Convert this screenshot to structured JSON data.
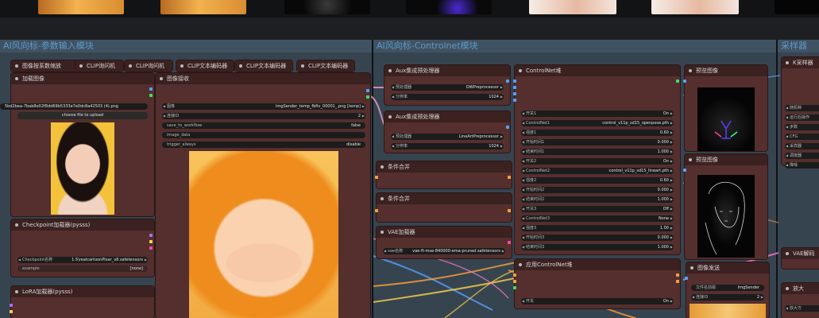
{
  "groups": {
    "left_title": "AI风向标-参数输入模块",
    "mid_title": "AI风向标-Controlnet模块",
    "right_title": "采样器"
  },
  "collapsed_nodes": {
    "resize": "图像按系数缩放",
    "clip1": "CLIP询问机",
    "clip2": "CLIP询问机",
    "clip3": "CLIP文本编码器",
    "clip4": "CLIP文本编码器",
    "clip5": "CLIP文本编码器"
  },
  "load_image": {
    "title": "加载图像",
    "filename": "5bd2bea-7bab8e02f8dd69b5333e7e0dc8a42503 (4).png",
    "upload_label": "choose file to upload"
  },
  "checkpoint": {
    "title": "Checkpoint加载器(pysss)",
    "ckpt_label": "Checkpoint名称",
    "ckpt_value": "1.5\\realcartoonPixar_v8.safetensors",
    "example_label": "example",
    "example_value": "[none]"
  },
  "lora": {
    "title": "LoRA加载器(pysss)"
  },
  "image_receive": {
    "title": "图像接收",
    "image_label": "图像",
    "image_value": "ImgSender_temp_fbfiv_00001_.png [temp]",
    "link_label": "连接ID",
    "link_value": "2",
    "save_label": "save_to_workflow",
    "save_value": "false",
    "image_data": "image_data",
    "trigger_label": "trigger_always",
    "trigger_value": "disable"
  },
  "preproc1": {
    "title": "Aux集成预处理器",
    "pre_label": "预处理器",
    "pre_value": "DWPreprocessor",
    "res_label": "分辨率",
    "res_value": "1024"
  },
  "preproc2": {
    "title": "Aux集成预处理器",
    "pre_label": "预处理器",
    "pre_value": "LineArtPreprocessor",
    "res_label": "分辨率",
    "res_value": "1024"
  },
  "cond1": {
    "title": "条件合并"
  },
  "cond2": {
    "title": "条件合并"
  },
  "vae": {
    "title": "VAE加载器",
    "vae_label": "vae名称",
    "vae_value": "vae-ft-mse-840000-ema-pruned.safetensors"
  },
  "cn_stack": {
    "title": "ControlNet堆",
    "rows": [
      {
        "label": "开关1",
        "value": "On"
      },
      {
        "label": "ControlNet1",
        "value": "control_v11p_sd15_openpose.pth"
      },
      {
        "label": "强度1",
        "value": "0.60"
      },
      {
        "label": "开始时间1",
        "value": "0.000"
      },
      {
        "label": "结束时间1",
        "value": "1.000"
      },
      {
        "label": "开关2",
        "value": "On"
      },
      {
        "label": "ControlNet2",
        "value": "control_v11p_sd15_lineart.pth"
      },
      {
        "label": "强度2",
        "value": "0.60"
      },
      {
        "label": "开始时间2",
        "value": "0.000"
      },
      {
        "label": "结束时间2",
        "value": "1.000"
      },
      {
        "label": "开关3",
        "value": "Off"
      },
      {
        "label": "ControlNet3",
        "value": "None"
      },
      {
        "label": "强度3",
        "value": "1.00"
      },
      {
        "label": "开始时间3",
        "value": "0.000"
      },
      {
        "label": "结束时间3",
        "value": "1.000"
      }
    ]
  },
  "apply_cn": {
    "title": "应用ControlNet堆",
    "switch_label": "开关",
    "switch_value": "On"
  },
  "preview1": {
    "title": "预览图像"
  },
  "preview2": {
    "title": "预览图像"
  },
  "image_send": {
    "title": "图像发送",
    "prefix_label": "文件名前缀",
    "prefix_value": "ImgSender",
    "link_label": "连接ID",
    "link_value": "2"
  },
  "ksampler": {
    "title": "K采样器",
    "rows": [
      "随机种",
      "运行后操作",
      "步数",
      "CFG",
      "采样器",
      "调度器",
      "降噪"
    ]
  },
  "vae_decode": {
    "title": "VAE解码"
  },
  "upscale": {
    "title": "放大",
    "row": "放大方"
  }
}
